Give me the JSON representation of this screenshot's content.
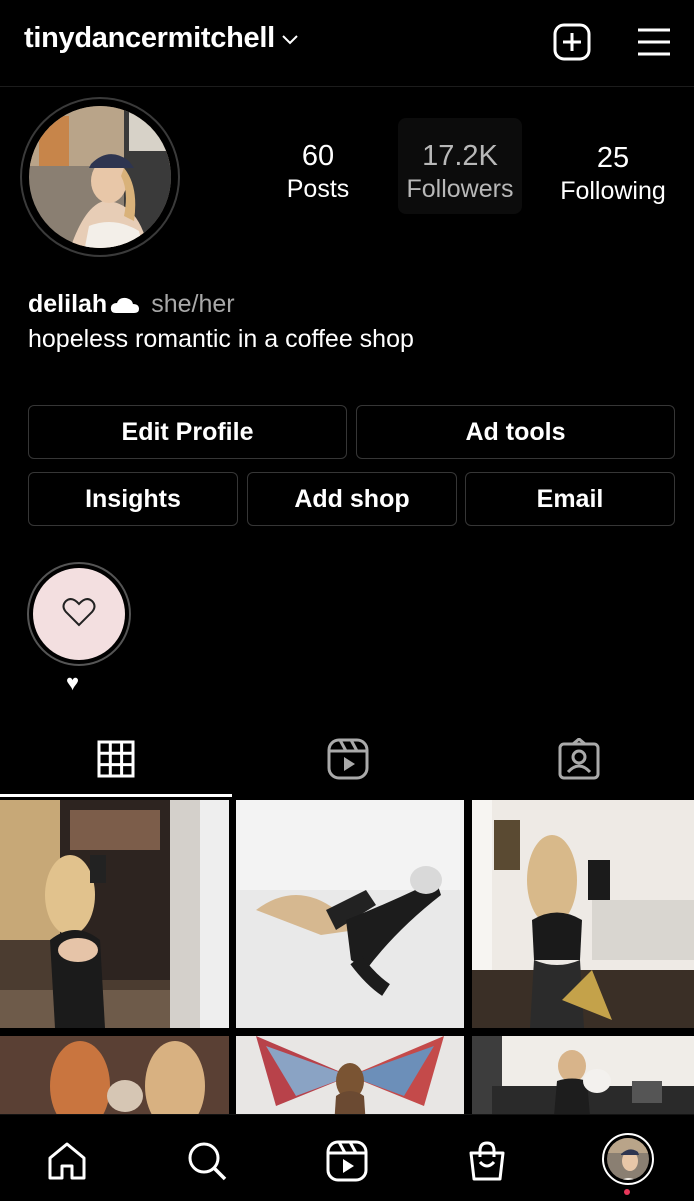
{
  "header": {
    "username": "tinydancermitchell",
    "icons": [
      "chevron-down-icon",
      "new-post-icon",
      "menu-icon"
    ]
  },
  "profile": {
    "stats": [
      {
        "value": "60",
        "label": "Posts"
      },
      {
        "value": "17.2K",
        "label": "Followers"
      },
      {
        "value": "25",
        "label": "Following"
      }
    ],
    "name": "delilah",
    "pronouns": "she/her",
    "bio": "hopeless romantic in a coffee shop"
  },
  "buttons": {
    "edit_profile": "Edit Profile",
    "ad_tools": "Ad tools",
    "insights": "Insights",
    "add_shop": "Add shop",
    "email": "Email"
  },
  "highlights": [
    {
      "label": "♥",
      "icon": "heart-outline-icon"
    }
  ],
  "tabs": [
    "grid-icon",
    "reels-icon",
    "tagged-icon"
  ],
  "nav": [
    "home-icon",
    "search-icon",
    "reels-icon",
    "shop-icon",
    "profile-avatar"
  ],
  "colors": {
    "background": "#000000",
    "button_border": "#363636",
    "highlight_bg": "#f3dfe0",
    "notification_dot": "#e8375a"
  }
}
